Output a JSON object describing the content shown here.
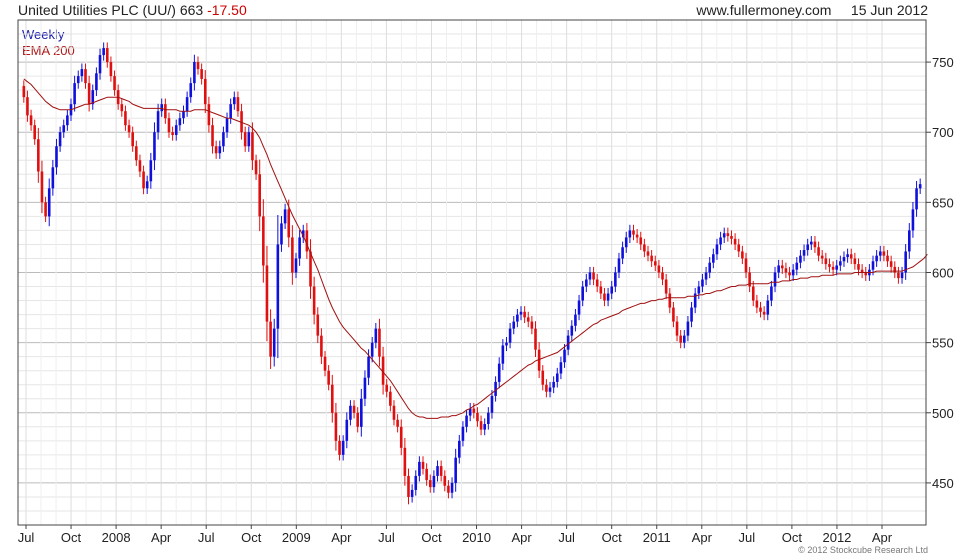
{
  "header": {
    "title": "United Utilities PLC (UU/) 663",
    "change": "-17.50",
    "site": "www.fullermoney.com",
    "date": "15 Jun 2012"
  },
  "legend": {
    "weekly": "Weekly",
    "ema": "EMA 200"
  },
  "copyright": "© 2012 Stockcube Research Ltd",
  "colors": {
    "up": "#1010dd",
    "down": "#e01010",
    "ema": "#a01010",
    "grid": "#cccccc",
    "frame": "#444444"
  },
  "chart_data": {
    "type": "candlestick",
    "title": "United Utilities PLC (UU/) 663",
    "ylim": [
      420,
      780
    ],
    "y_ticks": [
      450,
      500,
      550,
      600,
      650,
      700,
      750
    ],
    "y_axis_position": "right",
    "grid": true,
    "x_ticks": [
      "Jul",
      "Oct",
      "2008",
      "Apr",
      "Jul",
      "Oct",
      "2009",
      "Apr",
      "Jul",
      "Oct",
      "2010",
      "Apr",
      "Jul",
      "Oct",
      "2011",
      "Apr",
      "Jul",
      "Oct",
      "2012",
      "Apr"
    ],
    "close": [
      725,
      712,
      705,
      695,
      672,
      650,
      640,
      660,
      675,
      690,
      700,
      705,
      712,
      720,
      735,
      740,
      745,
      735,
      720,
      730,
      742,
      755,
      760,
      750,
      740,
      730,
      720,
      715,
      705,
      700,
      690,
      680,
      672,
      660,
      665,
      680,
      700,
      715,
      720,
      710,
      700,
      698,
      705,
      710,
      715,
      725,
      735,
      750,
      745,
      738,
      720,
      705,
      690,
      685,
      690,
      700,
      710,
      720,
      725,
      715,
      700,
      690,
      700,
      680,
      670,
      640,
      605,
      565,
      540,
      560,
      620,
      635,
      645,
      625,
      600,
      610,
      625,
      630,
      615,
      590,
      570,
      555,
      540,
      530,
      520,
      500,
      480,
      470,
      480,
      495,
      505,
      500,
      490,
      510,
      525,
      540,
      550,
      560,
      540,
      520,
      515,
      505,
      495,
      490,
      475,
      455,
      440,
      445,
      455,
      465,
      460,
      452,
      447,
      455,
      462,
      455,
      448,
      443,
      450,
      468,
      480,
      490,
      498,
      503,
      500,
      494,
      488,
      492,
      500,
      512,
      522,
      535,
      548,
      550,
      560,
      565,
      570,
      572,
      568,
      565,
      560,
      545,
      530,
      520,
      515,
      518,
      522,
      528,
      536,
      545,
      555,
      562,
      570,
      580,
      590,
      595,
      600,
      595,
      590,
      585,
      580,
      585,
      590,
      600,
      610,
      618,
      625,
      630,
      627,
      625,
      620,
      615,
      612,
      608,
      605,
      600,
      595,
      585,
      575,
      565,
      555,
      550,
      555,
      565,
      575,
      585,
      590,
      595,
      600,
      607,
      613,
      620,
      625,
      628,
      626,
      624,
      620,
      615,
      610,
      600,
      590,
      580,
      575,
      572,
      570,
      580,
      590,
      600,
      605,
      603,
      600,
      598,
      602,
      607,
      612,
      616,
      620,
      622,
      618,
      612,
      610,
      606,
      604,
      602,
      605,
      608,
      611,
      613,
      610,
      606,
      602,
      600,
      598,
      602,
      608,
      612,
      615,
      612,
      608,
      604,
      600,
      596,
      600,
      615,
      630,
      645,
      660,
      663
    ],
    "ema200": [
      738,
      736,
      734,
      731,
      728,
      725,
      722,
      720,
      718,
      717,
      716,
      716,
      716,
      716,
      717,
      718,
      719,
      720,
      720,
      721,
      722,
      723,
      724,
      725,
      725,
      725,
      725,
      724,
      723,
      722,
      720,
      719,
      718,
      717,
      717,
      717,
      717,
      717,
      717,
      716,
      716,
      716,
      716,
      715,
      715,
      715,
      715,
      716,
      716,
      716,
      716,
      715,
      714,
      713,
      712,
      711,
      710,
      710,
      709,
      708,
      707,
      706,
      705,
      703,
      700,
      696,
      690,
      684,
      677,
      671,
      665,
      659,
      653,
      647,
      641,
      636,
      631,
      626,
      620,
      614,
      608,
      602,
      595,
      588,
      581,
      575,
      570,
      565,
      561,
      558,
      555,
      552,
      549,
      546,
      544,
      541,
      538,
      535,
      532,
      529,
      526,
      523,
      519,
      515,
      511,
      507,
      503,
      500,
      498,
      497,
      497,
      496,
      496,
      496,
      496,
      497,
      497,
      497,
      498,
      498,
      499,
      500,
      502,
      503,
      505,
      506,
      508,
      510,
      512,
      514,
      516,
      518,
      520,
      522,
      524,
      526,
      528,
      530,
      532,
      534,
      535,
      537,
      538,
      539,
      540,
      541,
      542,
      543,
      545,
      547,
      549,
      551,
      553,
      555,
      557,
      559,
      561,
      563,
      564,
      566,
      567,
      568,
      569,
      570,
      571,
      573,
      574,
      575,
      576,
      577,
      578,
      578,
      579,
      580,
      580,
      581,
      581,
      582,
      582,
      582,
      582,
      582,
      582,
      583,
      583,
      583,
      584,
      584,
      585,
      585,
      586,
      587,
      587,
      588,
      589,
      590,
      590,
      591,
      591,
      591,
      592,
      592,
      592,
      592,
      592,
      592,
      593,
      593,
      593,
      594,
      594,
      594,
      595,
      595,
      596,
      596,
      596,
      597,
      597,
      597,
      598,
      598,
      598,
      598,
      599,
      599,
      599,
      599,
      599,
      600,
      600,
      600,
      600,
      600,
      600,
      601,
      601,
      601,
      601,
      601,
      601,
      601,
      601,
      602,
      603,
      604,
      606,
      608,
      610,
      613
    ]
  }
}
